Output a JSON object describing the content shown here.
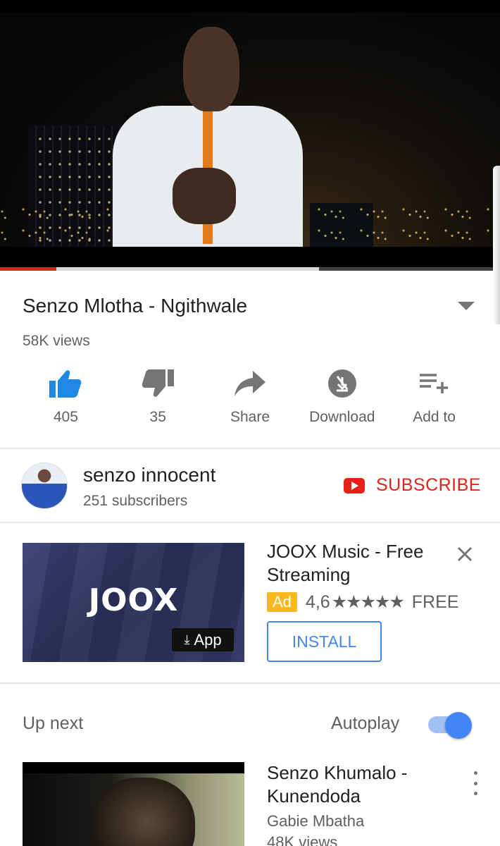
{
  "video": {
    "title": "Senzo Mlotha - Ngithwale",
    "views": "58K views",
    "progress": {
      "played_fraction": 0.113,
      "buffered_fraction": 0.638
    }
  },
  "actions": [
    {
      "label": "405",
      "icon": "thumbs-up-icon",
      "color": "#1e88e5"
    },
    {
      "label": "35",
      "icon": "thumbs-down-icon",
      "color": "#757575"
    },
    {
      "label": "Share",
      "icon": "share-icon",
      "color": "#757575"
    },
    {
      "label": "Download",
      "icon": "download-disabled-icon",
      "color": "#757575"
    },
    {
      "label": "Add to",
      "icon": "playlist-add-icon",
      "color": "#757575"
    }
  ],
  "channel": {
    "name": "senzo innocent",
    "subscribers": "251 subscribers",
    "subscribe_label": "SUBSCRIBE",
    "subscribe_color": "#e62117"
  },
  "ad": {
    "logo_text": "JOOX",
    "app_badge": "App",
    "title": "JOOX Music - Free Streaming",
    "badge": "Ad",
    "rating": "4,6",
    "stars": "★★★★★",
    "price": "FREE",
    "install_label": "INSTALL",
    "accent": "#4285f4"
  },
  "up_next": {
    "label": "Up next",
    "autoplay_label": "Autoplay",
    "autoplay_on": true,
    "item": {
      "title": "Senzo Khumalo - Kunendoda",
      "channel": "Gabie Mbatha",
      "views": "48K views"
    }
  }
}
